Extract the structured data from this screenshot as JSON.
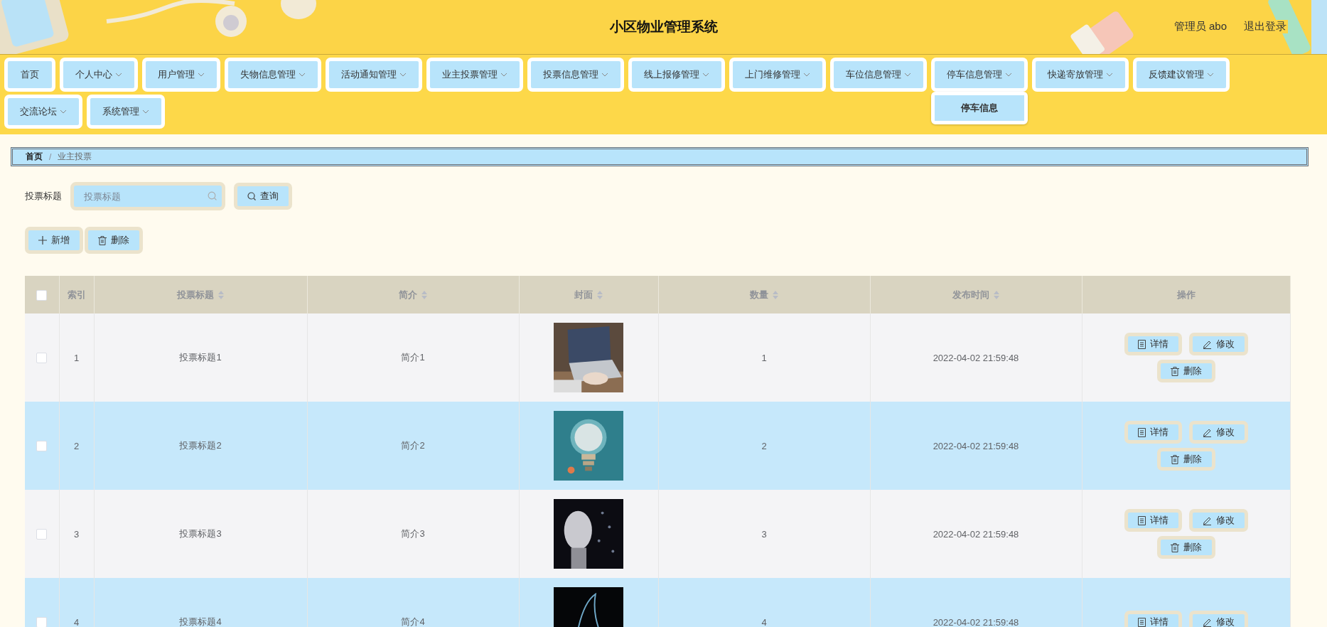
{
  "header": {
    "title": "小区物业管理系统",
    "user": "管理员 abo",
    "logout": "退出登录"
  },
  "nav": [
    {
      "label": "首页",
      "kind": "link"
    },
    {
      "label": "个人中心",
      "kind": "menu"
    },
    {
      "label": "用户管理",
      "kind": "menu"
    },
    {
      "label": "失物信息管理",
      "kind": "menu"
    },
    {
      "label": "活动通知管理",
      "kind": "menu"
    },
    {
      "label": "业主投票管理",
      "kind": "menu"
    },
    {
      "label": "投票信息管理",
      "kind": "menu"
    },
    {
      "label": "线上报修管理",
      "kind": "menu"
    },
    {
      "label": "上门维修管理",
      "kind": "menu"
    },
    {
      "label": "车位信息管理",
      "kind": "menu"
    },
    {
      "label": "停车信息管理",
      "kind": "menu",
      "children": [
        {
          "label": "停车信息"
        }
      ]
    },
    {
      "label": "快递寄放管理",
      "kind": "menu"
    },
    {
      "label": "反馈建议管理",
      "kind": "menu"
    },
    {
      "label": "交流论坛",
      "kind": "menu"
    },
    {
      "label": "系统管理",
      "kind": "menu"
    }
  ],
  "breadcrumb": {
    "separator": "/",
    "items": [
      {
        "label": "首页",
        "current": false
      },
      {
        "label": "业主投票",
        "current": true
      }
    ]
  },
  "search": {
    "label": "投票标题",
    "placeholder": "投票标题",
    "button": "查询"
  },
  "toolbar": [
    {
      "label": "新增",
      "kind": "add"
    },
    {
      "label": "删除",
      "kind": "delete"
    }
  ],
  "table": {
    "columns": [
      {
        "kind": "checkbox",
        "checked": false
      },
      {
        "kind": "text",
        "label": "索引",
        "sortable": false
      },
      {
        "kind": "text",
        "label": "投票标题",
        "sortable": true
      },
      {
        "kind": "text",
        "label": "简介",
        "sortable": true
      },
      {
        "kind": "text",
        "label": "封面",
        "sortable": true
      },
      {
        "kind": "text",
        "label": "数量",
        "sortable": true
      },
      {
        "kind": "text",
        "label": "发布时间",
        "sortable": true
      },
      {
        "kind": "text",
        "label": "操作",
        "sortable": false
      }
    ],
    "rows": [
      {
        "checked": false,
        "index": "1",
        "title": "投票标题1",
        "summary": "简介1",
        "cover": {
          "kind": "picture"
        },
        "count": "1",
        "time": "2022-04-02 21:59:48",
        "actions": [
          {
            "label": "详情",
            "kind": "detail"
          },
          {
            "label": "修改",
            "kind": "edit"
          },
          {
            "label": "删除",
            "kind": "delete"
          }
        ]
      },
      {
        "checked": false,
        "index": "2",
        "title": "投票标题2",
        "summary": "简介2",
        "cover": {
          "kind": "picture"
        },
        "count": "2",
        "time": "2022-04-02 21:59:48",
        "actions": [
          {
            "label": "详情",
            "kind": "detail"
          },
          {
            "label": "修改",
            "kind": "edit"
          },
          {
            "label": "删除",
            "kind": "delete"
          }
        ]
      },
      {
        "checked": false,
        "index": "3",
        "title": "投票标题3",
        "summary": "简介3",
        "cover": {
          "kind": "picture"
        },
        "count": "3",
        "time": "2022-04-02 21:59:48",
        "actions": [
          {
            "label": "详情",
            "kind": "detail"
          },
          {
            "label": "修改",
            "kind": "edit"
          },
          {
            "label": "删除",
            "kind": "delete"
          }
        ]
      },
      {
        "checked": false,
        "index": "4",
        "title": "投票标题4",
        "summary": "简介4",
        "cover": {
          "kind": "picture"
        },
        "count": "4",
        "time": "2022-04-02 21:59:48",
        "actions": [
          {
            "label": "详情",
            "kind": "detail"
          },
          {
            "label": "修改",
            "kind": "edit"
          }
        ]
      }
    ]
  }
}
